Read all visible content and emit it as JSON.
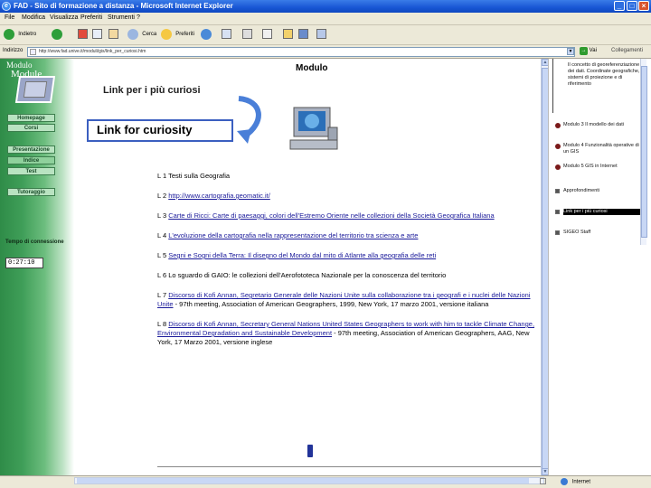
{
  "window": {
    "title": "FAD - Sito di formazione a distanza - Microsoft Internet Explorer",
    "app_icon": "ie-icon",
    "controls": [
      "_",
      "□",
      "×"
    ]
  },
  "menu": [
    "File",
    "Modifica",
    "Visualizza",
    "Preferiti",
    "Strumenti",
    "?"
  ],
  "toolbar": {
    "back_label": "Indietro",
    "search_label": "Cerca",
    "favorites_label": "Preferiti"
  },
  "address": {
    "label": "Indirizzo",
    "value": "http://www.fad.unive.it/moduli/gis/link_per_curiosi.htm",
    "go_label": "Vai",
    "links_label": "Collegamenti"
  },
  "sidebar": {
    "header_top": "Modulo",
    "header_main": "Module",
    "nav": [
      {
        "label": "Homepage",
        "active": false
      },
      {
        "label": "Corsi",
        "active": false
      },
      {
        "label": "Presentazione",
        "active": false
      },
      {
        "label": "Indice",
        "active": true
      },
      {
        "label": "Test",
        "active": false
      },
      {
        "label": "Tutoraggio",
        "active": false
      }
    ],
    "time_label": "Tempo di connessione",
    "time_value": "0:27:10"
  },
  "main": {
    "heading": "Modulo",
    "subheading": "Link per i più curiosi",
    "callout": "Link for curiosity",
    "references": [
      {
        "num": "L 1",
        "link": "",
        "text": "Testi sulla Geografia"
      },
      {
        "num": "L 2",
        "link": "http://www.cartografia.geomatic.it/",
        "text": ""
      },
      {
        "num": "L 3",
        "link": "Carte di Ricci: Carte di paesaggi, colori dell'Estremo Oriente nelle collezioni della Società Geografica Italiana",
        "text": ""
      },
      {
        "num": "L 4",
        "link": "L'evoluzione della cartografia nella rappresentazione del territorio tra scienza e arte",
        "text": ""
      },
      {
        "num": "L 5",
        "link": "Segni e Sogni della Terra: Il disegno del Mondo dal mito di Atlante alla geografia delle reti",
        "text": ""
      },
      {
        "num": "L 6",
        "link": "",
        "text": "Lo sguardo di GAIO: le collezioni dell'Aerofototeca Nazionale per la conoscenza del territorio"
      },
      {
        "num": "L 7",
        "link": "Discorso di Kofi Annan, Segretario Generale delle Nazioni Unite sulla collaborazione tra i geografi e i nuclei delle Nazioni Unite",
        "text": " - 97th meeting, Association of American Geographers, 1999, New York, 17 marzo 2001, versione italiana"
      },
      {
        "num": "L 8",
        "link": "Discorso di Kofi Annan, Secretary General Nations United States Geographers to work with him to tackle Climate Change, Environmental Degradation and Sustainable Development",
        "text": " - 97th meeting, Association of American Geographers, AAG, New York, 17 Marzo 2001, versione inglese"
      }
    ]
  },
  "right_panel": {
    "items": [
      {
        "label": "Il concetto di georeferenziazione dei dati. Coordinate geografiche, sistemi di proiezione e di riferimento",
        "style": "line"
      },
      {
        "label": "Modulo 3 Il modello dei dati",
        "style": "book"
      },
      {
        "label": "Modulo 4 Funzionalità operative di un GIS",
        "style": "book"
      },
      {
        "label": "Modulo 5 GIS in Internet",
        "style": "book"
      },
      {
        "label": "Approfondimenti",
        "style": "page"
      },
      {
        "label": "Link per i più curiosi",
        "style": "page",
        "selected": true
      },
      {
        "label": "SIGEO Staff",
        "style": "page"
      }
    ]
  },
  "status": {
    "zone": "Internet"
  }
}
